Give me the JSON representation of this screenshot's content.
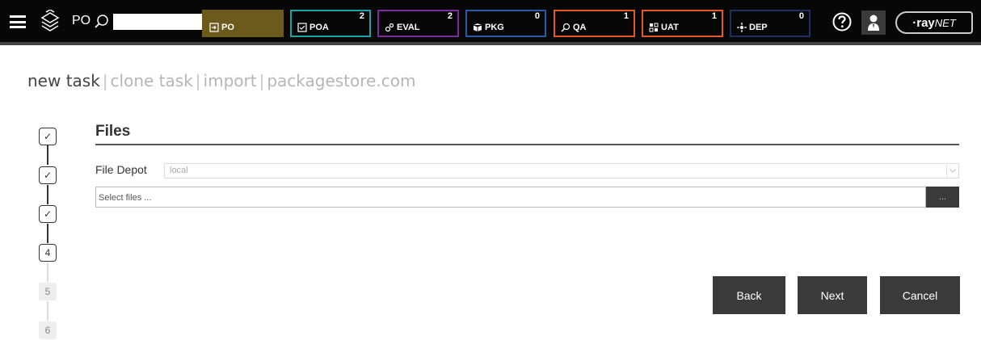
{
  "header": {
    "app_label": "PO",
    "search": {
      "value": "",
      "placeholder": ""
    },
    "stages": [
      {
        "id": "po",
        "label": "PO",
        "count": "",
        "icon": "document-arrow-icon",
        "color": "#6b5a1c",
        "active": true
      },
      {
        "id": "poa",
        "label": "POA",
        "count": "2",
        "icon": "document-check-icon",
        "color": "#18a4a8"
      },
      {
        "id": "eval",
        "label": "EVAL",
        "count": "2",
        "icon": "gears-icon",
        "color": "#7c2b9e"
      },
      {
        "id": "pkg",
        "label": "PKG",
        "count": "0",
        "icon": "package-icon",
        "color": "#2a59a6"
      },
      {
        "id": "qa",
        "label": "QA",
        "count": "1",
        "icon": "magnifier-icon",
        "color": "#e2582a"
      },
      {
        "id": "uat",
        "label": "UAT",
        "count": "1",
        "icon": "grid-check-icon",
        "color": "#e2582a"
      },
      {
        "id": "dep",
        "label": "DEP",
        "count": "0",
        "icon": "deploy-arrows-icon",
        "color": "#1d2f63"
      }
    ],
    "brand": {
      "prefix": "·ray",
      "suffix": "NET"
    }
  },
  "nav_tabs": [
    {
      "label": "new task",
      "active": true
    },
    {
      "label": "clone task"
    },
    {
      "label": "import"
    },
    {
      "label": "packagestore.com"
    }
  ],
  "steps": [
    {
      "label": "✓",
      "state": "done"
    },
    {
      "label": "✓",
      "state": "done"
    },
    {
      "label": "✓",
      "state": "done"
    },
    {
      "label": "4",
      "state": "current"
    },
    {
      "label": "5",
      "state": "future"
    },
    {
      "label": "6",
      "state": "future"
    }
  ],
  "form": {
    "title": "Files",
    "depot_label": "File Depot",
    "depot_value": "local",
    "files_placeholder": "Select files ...",
    "browse_label": "..."
  },
  "actions": {
    "back": "Back",
    "next": "Next",
    "cancel": "Cancel"
  }
}
